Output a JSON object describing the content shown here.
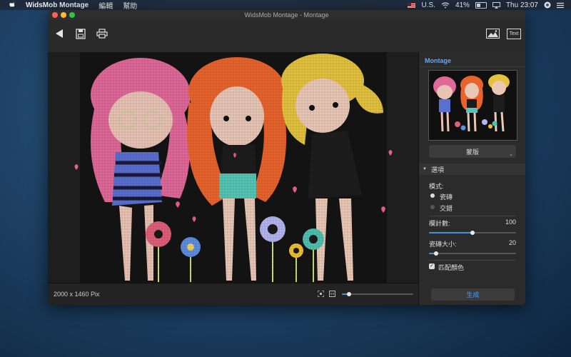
{
  "menubar": {
    "app_name": "WidsMob Montage",
    "menu_edit": "編輯",
    "menu_help": "幫助",
    "input_source": "U.S.",
    "battery": "41%",
    "clock": "Thu 23:07"
  },
  "window": {
    "title": "WidsMob Montage - Montage"
  },
  "toolbar": {
    "text_label": "Text"
  },
  "sidebar": {
    "tab_label": "Montage",
    "mask_button": "蒙版",
    "options_header": "選項",
    "mode_label": "模式:",
    "mode_tile": "瓷磚",
    "mode_alternate": "交錯",
    "columns_label": "欄計數:",
    "columns_value": "100",
    "columns_level": 0.5,
    "tile_size_label": "瓷磚大小:",
    "tile_size_value": "20",
    "tile_size_level": 0.08,
    "match_color_label": "匹配顏色"
  },
  "statusbar": {
    "dimensions": "2000 x 1460 Pix",
    "zoom_level": 0.1
  },
  "generate_button": "生成",
  "colors": {
    "accent": "#4a90e2",
    "link_blue": "#5da9ff",
    "window_bg": "#1b1b1b"
  }
}
